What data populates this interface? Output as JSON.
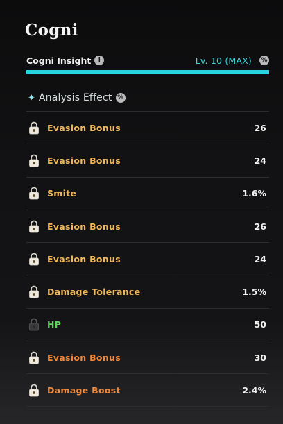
{
  "panel": {
    "title": "Cogni"
  },
  "insight": {
    "label": "Cogni Insight",
    "info_icon": "info-icon",
    "level": "Lv. 10 (MAX)",
    "rate_icon": "percent-icon",
    "progress": 1.0,
    "accent_color": "#26d5df"
  },
  "analysis": {
    "title": "Analysis Effect",
    "icon": "sparkle-icon",
    "rate_icon": "percent-icon",
    "effects": [
      {
        "name": "Evasion Bonus",
        "value": "26",
        "color": "#f0b85a",
        "locked": true,
        "dim": false
      },
      {
        "name": "Evasion Bonus",
        "value": "24",
        "color": "#f0b85a",
        "locked": true,
        "dim": false
      },
      {
        "name": "Smite",
        "value": "1.6%",
        "color": "#f0b85a",
        "locked": true,
        "dim": false
      },
      {
        "name": "Evasion Bonus",
        "value": "26",
        "color": "#f0b85a",
        "locked": true,
        "dim": false
      },
      {
        "name": "Evasion Bonus",
        "value": "24",
        "color": "#f0b85a",
        "locked": true,
        "dim": false
      },
      {
        "name": "Damage Tolerance",
        "value": "1.5%",
        "color": "#f0b85a",
        "locked": true,
        "dim": false
      },
      {
        "name": "HP",
        "value": "50",
        "color": "#5fd35a",
        "locked": true,
        "dim": true
      },
      {
        "name": "Evasion Bonus",
        "value": "30",
        "color": "#f0883a",
        "locked": true,
        "dim": false
      },
      {
        "name": "Damage Boost",
        "value": "2.4%",
        "color": "#f0883a",
        "locked": true,
        "dim": false
      }
    ]
  }
}
